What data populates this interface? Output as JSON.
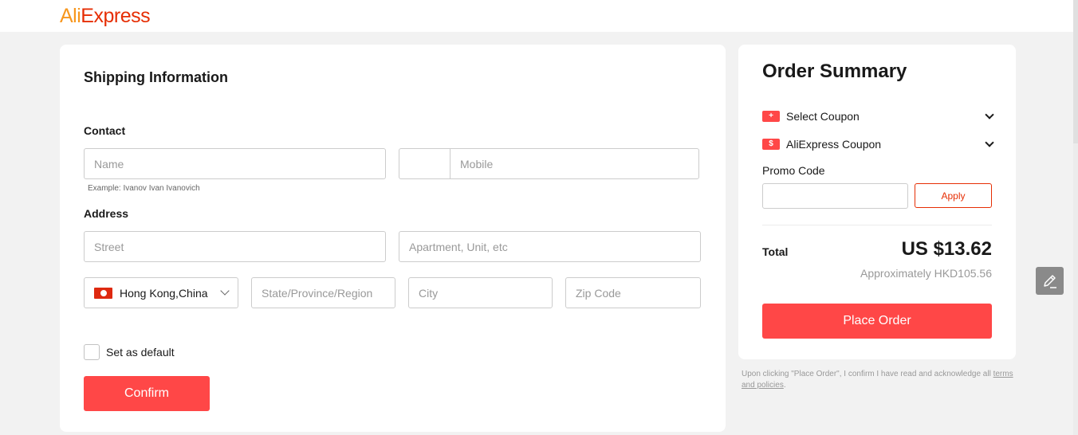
{
  "logo": {
    "part1": "Ali",
    "part2": "Express"
  },
  "shipping": {
    "title": "Shipping Information",
    "contact_label": "Contact",
    "name_placeholder": "Name",
    "name_hint": "Example: Ivanov Ivan Ivanovich",
    "mobile_placeholder": "Mobile",
    "address_label": "Address",
    "street_placeholder": "Street",
    "apartment_placeholder": "Apartment, Unit, etc",
    "country": "Hong Kong,China",
    "state_placeholder": "State/Province/Region",
    "city_placeholder": "City",
    "zip_placeholder": "Zip Code",
    "default_label": "Set as default",
    "confirm_label": "Confirm"
  },
  "summary": {
    "title": "Order Summary",
    "select_coupon": "Select Coupon",
    "ae_coupon": "AliExpress Coupon",
    "promo_label": "Promo Code",
    "apply_label": "Apply",
    "total_label": "Total",
    "total_value": "US $13.62",
    "approx": "Approximately HKD105.56",
    "place_order": "Place Order"
  },
  "note": {
    "text": "Upon clicking \"Place Order\", I confirm I have read and acknowledge all",
    "link": "terms and policies",
    "suffix": "."
  },
  "colors": {
    "accent": "#ff4747",
    "link_red": "#e62e04",
    "logo_orange": "#f7971e"
  },
  "icons": [
    "coupon-icon",
    "dollar-coupon-icon",
    "chevron-down-icon",
    "hk-flag-icon",
    "edit-pencil-icon"
  ]
}
